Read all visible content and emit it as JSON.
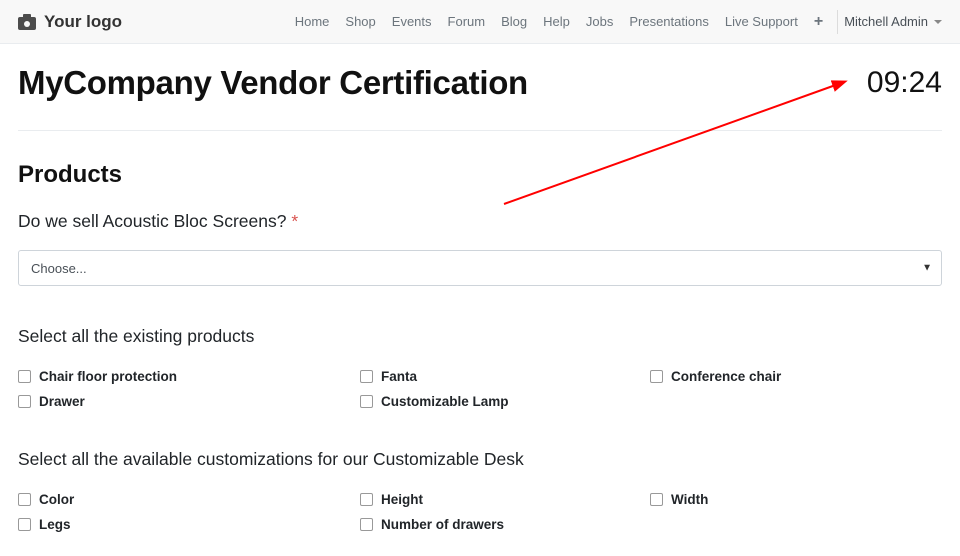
{
  "header": {
    "logo_text": "Your logo",
    "nav": [
      "Home",
      "Shop",
      "Events",
      "Forum",
      "Blog",
      "Help",
      "Jobs",
      "Presentations",
      "Live Support"
    ],
    "user": "Mitchell Admin"
  },
  "page": {
    "title": "MyCompany Vendor Certification",
    "timer": "09:24",
    "section_title": "Products",
    "q1": {
      "label": "Do we sell Acoustic Bloc Screens?",
      "required_marker": "*",
      "placeholder": "Choose..."
    },
    "q2": {
      "label": "Select all the existing products",
      "options": [
        "Chair floor protection",
        "Fanta",
        "Conference chair",
        "Drawer",
        "Customizable Lamp"
      ]
    },
    "q3": {
      "label": "Select all the available customizations for our Customizable Desk",
      "options": [
        "Color",
        "Height",
        "Width",
        "Legs",
        "Number of drawers"
      ]
    }
  }
}
